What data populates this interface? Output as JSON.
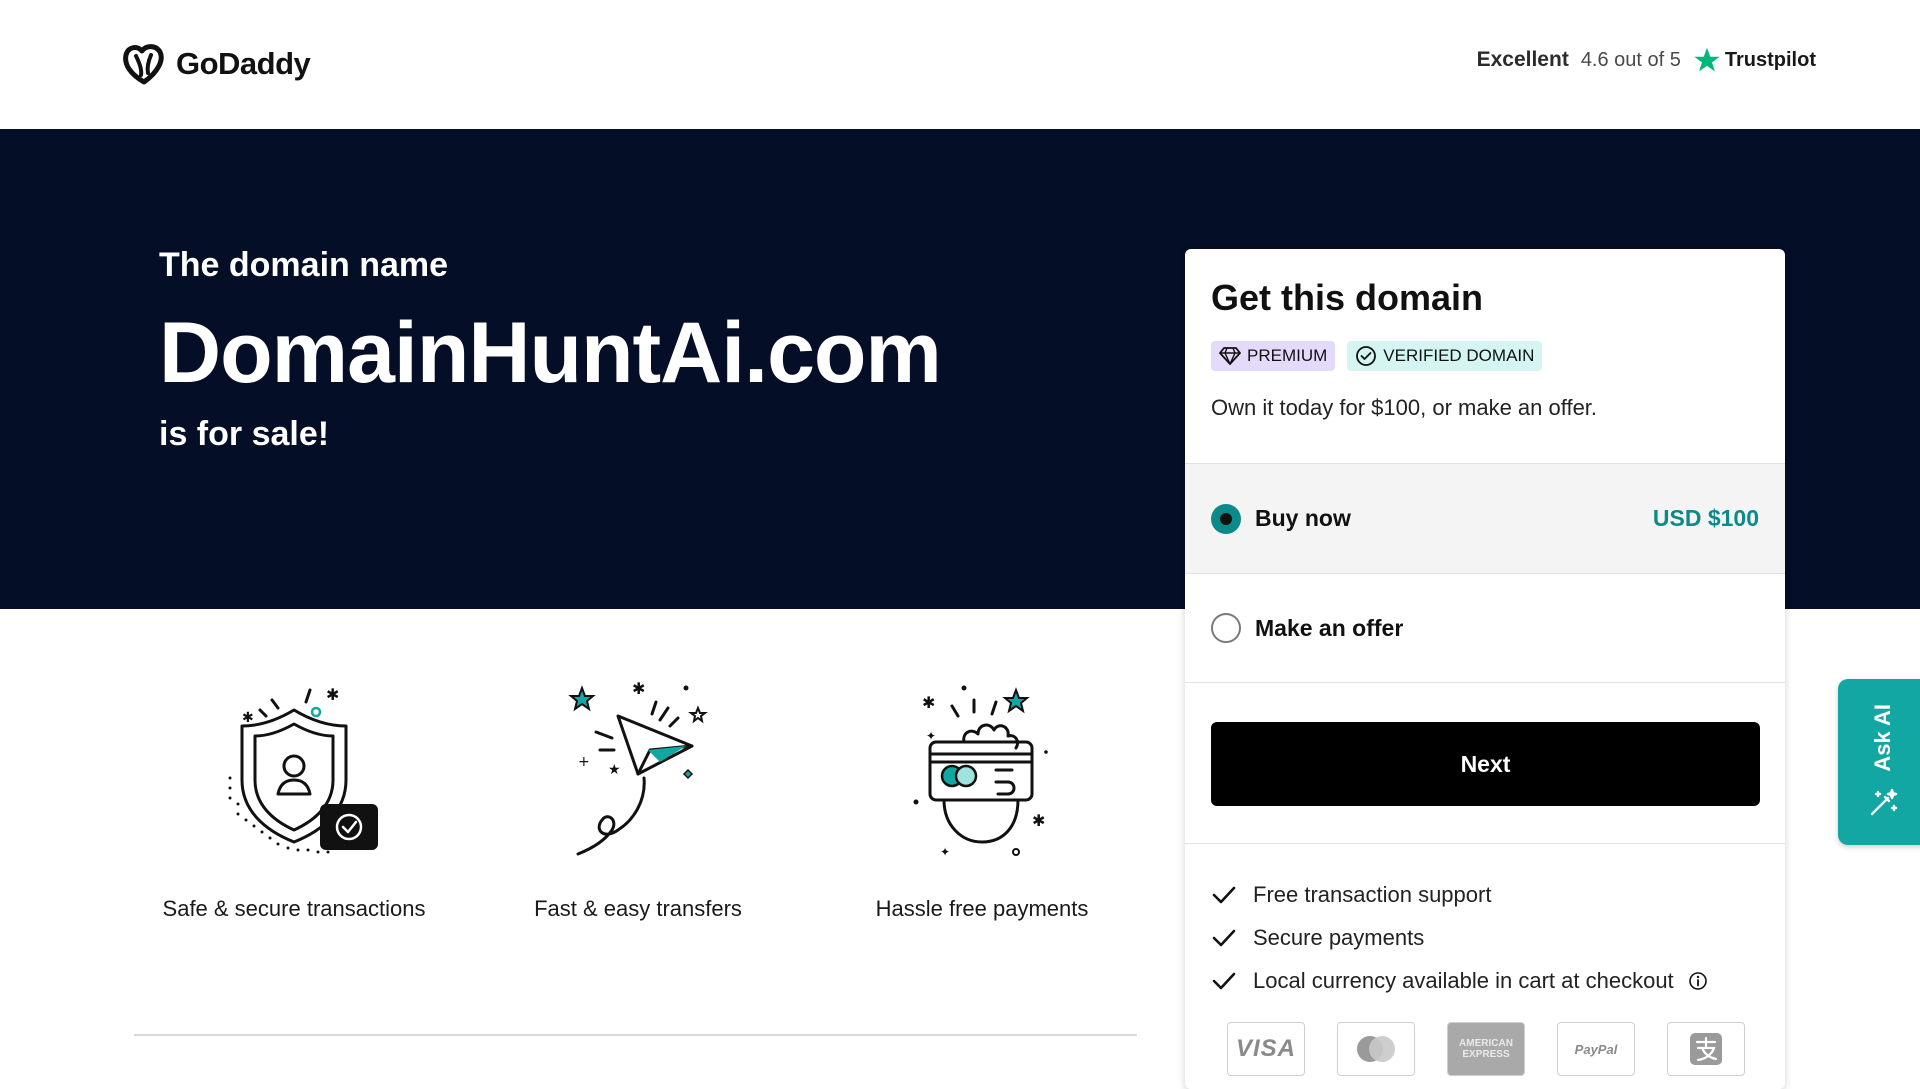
{
  "header": {
    "brand": "GoDaddy",
    "trustpilot": {
      "excellent": "Excellent",
      "rating": "4.6 out of 5",
      "brand": "Trustpilot",
      "star_color": "#00b67a"
    }
  },
  "hero": {
    "pre": "The domain name",
    "domain": "DomainHuntAi.com",
    "post": "is for sale!",
    "background": "#040e27"
  },
  "features": [
    {
      "icon": "shield-user-check-icon",
      "label": "Safe & secure transactions"
    },
    {
      "icon": "paper-plane-icon",
      "label": "Fast & easy transfers"
    },
    {
      "icon": "hand-card-payment-icon",
      "label": "Hassle free payments"
    }
  ],
  "card": {
    "title": "Get this domain",
    "badges": {
      "premium": "PREMIUM",
      "verified": "VERIFIED DOMAIN"
    },
    "description": "Own it today for $100, or make an offer.",
    "options": {
      "buy": {
        "label": "Buy now",
        "price": "USD $100",
        "selected": true
      },
      "offer": {
        "label": "Make an offer",
        "selected": false
      }
    },
    "next_label": "Next",
    "benefits": [
      "Free transaction support",
      "Secure payments",
      "Local currency available in cart at checkout"
    ],
    "payments": {
      "visa": "VISA",
      "amex": "AMERICAN EXPRESS",
      "paypal": "PayPal"
    },
    "accent": "#0c8a8a"
  },
  "ask_ai": {
    "label": "Ask AI",
    "color": "#13a7a4"
  }
}
